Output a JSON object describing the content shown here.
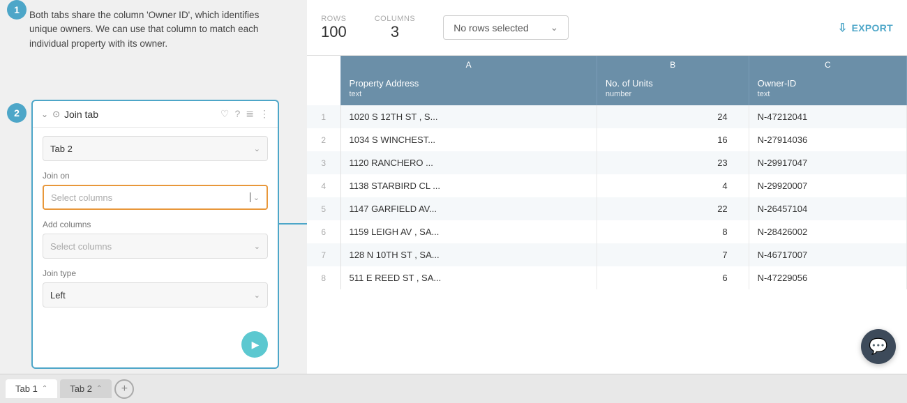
{
  "step1": {
    "number": "1",
    "description": "Both tabs share the column 'Owner ID', which identifies unique owners. We can use that column to match each individual property with its owner."
  },
  "step2": {
    "number": "2"
  },
  "stats": {
    "rows_label": "ROWS",
    "rows_value": "100",
    "columns_label": "COLUMNS",
    "columns_value": "3",
    "no_rows_selected": "No rows selected",
    "export_label": "EXPORT"
  },
  "join_panel": {
    "title": "Join tab",
    "tab_value": "Tab 2",
    "join_on_label": "Join on",
    "join_on_placeholder": "Select columns",
    "add_columns_label": "Add columns",
    "add_columns_placeholder": "Select columns",
    "join_type_label": "Join type",
    "join_type_value": "Left"
  },
  "table": {
    "col_headers": [
      "A",
      "B",
      "C"
    ],
    "sub_headers": [
      {
        "name": "Property Address",
        "type": "text"
      },
      {
        "name": "No. of Units",
        "type": "number"
      },
      {
        "name": "Owner-ID",
        "type": "text"
      }
    ],
    "rows": [
      {
        "num": "1",
        "address": "1020 S 12TH ST , S...",
        "units": "24",
        "owner_id": "N-47212041"
      },
      {
        "num": "2",
        "address": "1034 S WINCHEST...",
        "units": "16",
        "owner_id": "N-27914036"
      },
      {
        "num": "3",
        "address": "1120 RANCHERO ...",
        "units": "23",
        "owner_id": "N-29917047"
      },
      {
        "num": "4",
        "address": "1138 STARBIRD CL ...",
        "units": "4",
        "owner_id": "N-29920007"
      },
      {
        "num": "5",
        "address": "1147 GARFIELD AV...",
        "units": "22",
        "owner_id": "N-26457104"
      },
      {
        "num": "6",
        "address": "1159 LEIGH AV , SA...",
        "units": "8",
        "owner_id": "N-28426002"
      },
      {
        "num": "7",
        "address": "128 N 10TH ST , SA...",
        "units": "7",
        "owner_id": "N-46717007"
      },
      {
        "num": "8",
        "address": "511 E REED ST , SA...",
        "units": "6",
        "owner_id": "N-47229056"
      }
    ]
  },
  "tabs": {
    "tab1_label": "Tab 1",
    "tab2_label": "Tab 2",
    "add_label": "+"
  }
}
